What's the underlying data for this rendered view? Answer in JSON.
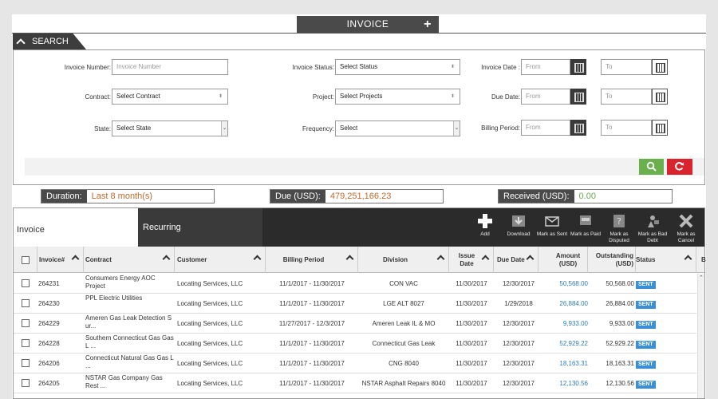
{
  "header": {
    "title": "INVOICE",
    "add_symbol": "+"
  },
  "search": {
    "tab_label": "SEARCH",
    "invoice_number": {
      "label": "Invoice Number:",
      "placeholder": "Invoice Number"
    },
    "contract": {
      "label": "Contract:",
      "value": "Select Contract"
    },
    "state": {
      "label": "State:",
      "value": "Select State"
    },
    "invoice_status": {
      "label": "Invoice Status:",
      "value": "Select Status"
    },
    "project": {
      "label": "Project:",
      "value": "Select Projects"
    },
    "frequency": {
      "label": "Frequency:",
      "value": "Select"
    },
    "invoice_date": {
      "label": "Invoice Date :",
      "from": "From",
      "to": "To"
    },
    "due_date": {
      "label": "Due Date:",
      "from": "From",
      "to": "To"
    },
    "billing_period": {
      "label": "Billing Period:",
      "from": "From",
      "to": "To"
    }
  },
  "summary": {
    "duration_label": "Duration:",
    "duration_value": "Last 8 month(s)",
    "due_label": "Due (USD):",
    "due_value": "479,251,166.23",
    "received_label": "Received (USD):",
    "received_value": "0.00"
  },
  "tabs": {
    "invoice": "Invoice",
    "recurring": "Recurring"
  },
  "actions": [
    {
      "name": "add",
      "label": "Add"
    },
    {
      "name": "download",
      "label": "Download"
    },
    {
      "name": "mark-as-sent",
      "label": "Mark as Sent"
    },
    {
      "name": "mark-as-paid",
      "label": "Mark as Paid"
    },
    {
      "name": "mark-as-disputed",
      "label": "Mark as Disputed"
    },
    {
      "name": "mark-as-bad-debt",
      "label": "Mark as Bad Debt"
    },
    {
      "name": "mark-as-cancel",
      "label": "Mark as Cancel"
    }
  ],
  "columns": {
    "invoice": "Invoice#",
    "contract": "Contract",
    "customer": "Customer",
    "billing_period": "Billing Period",
    "division": "Division",
    "issue_date": "Issue Date",
    "due_date": "Due Date",
    "amount": "Amount (USD)",
    "outstanding": "Outstanding (USD)",
    "status": "Status",
    "extra": "B"
  },
  "rows": [
    {
      "invoice": "264231",
      "contract": "Consumers Energy AOC Project",
      "customer": "Locating Services, LLC",
      "billing_period": "11/1/2017 - 11/30/2017",
      "division": "CON VAC",
      "issue_date": "11/30/2017",
      "due_date": "12/30/2017",
      "amount": "50,568.00",
      "outstanding": "50,568.00",
      "status": "SENT"
    },
    {
      "invoice": "264230",
      "contract": "PPL Electric Utilities",
      "customer": "Locating Services, LLC",
      "billing_period": "11/1/2017 - 11/30/2017",
      "division": "LGE ALT 8027",
      "issue_date": "11/30/2017",
      "due_date": "1/29/2018",
      "amount": "26,884.00",
      "outstanding": "26,884.00",
      "status": "SENT"
    },
    {
      "invoice": "264229",
      "contract": "Ameren Gas Leak Detection S ur...",
      "customer": "Locating Services, LLC",
      "billing_period": "11/27/2017 - 12/3/2017",
      "division": "Ameren Leak IL & MO",
      "issue_date": "11/30/2017",
      "due_date": "12/30/2017",
      "amount": "9,933.00",
      "outstanding": "9,933.00",
      "status": "SENT"
    },
    {
      "invoice": "264228",
      "contract": "Southern Connecticut Gas Gas L ...",
      "customer": "Locating Services, LLC",
      "billing_period": "11/1/2017 - 11/30/2017",
      "division": "Connecticut Gas Leak",
      "issue_date": "11/30/2017",
      "due_date": "12/30/2017",
      "amount": "52,929.22",
      "outstanding": "52,929.22",
      "status": "SENT"
    },
    {
      "invoice": "264206",
      "contract": "Connecticut Natural Gas Gas L ...",
      "customer": "Locating Services, LLC",
      "billing_period": "11/1/2017 - 11/30/2017",
      "division": "CNG 8040",
      "issue_date": "11/30/2017",
      "due_date": "12/30/2017",
      "amount": "18,163.31",
      "outstanding": "18,163.31",
      "status": "SENT"
    },
    {
      "invoice": "264205",
      "contract": "NSTAR Gas Company Gas Rest ...",
      "customer": "Locating Services, LLC",
      "billing_period": "11/1/2017 - 11/30/2017",
      "division": "NSTAR Asphalt Repairs 8040",
      "issue_date": "11/30/2017",
      "due_date": "12/30/2017",
      "amount": "12,130.56",
      "outstanding": "12,130.56",
      "status": "SENT"
    }
  ],
  "colors": {
    "accent_orange": "#c0692a",
    "status_blue": "#3a8fd6",
    "search_green": "#6ab04c",
    "reset_red": "#d9232d",
    "dark": "#3a3a3a"
  }
}
